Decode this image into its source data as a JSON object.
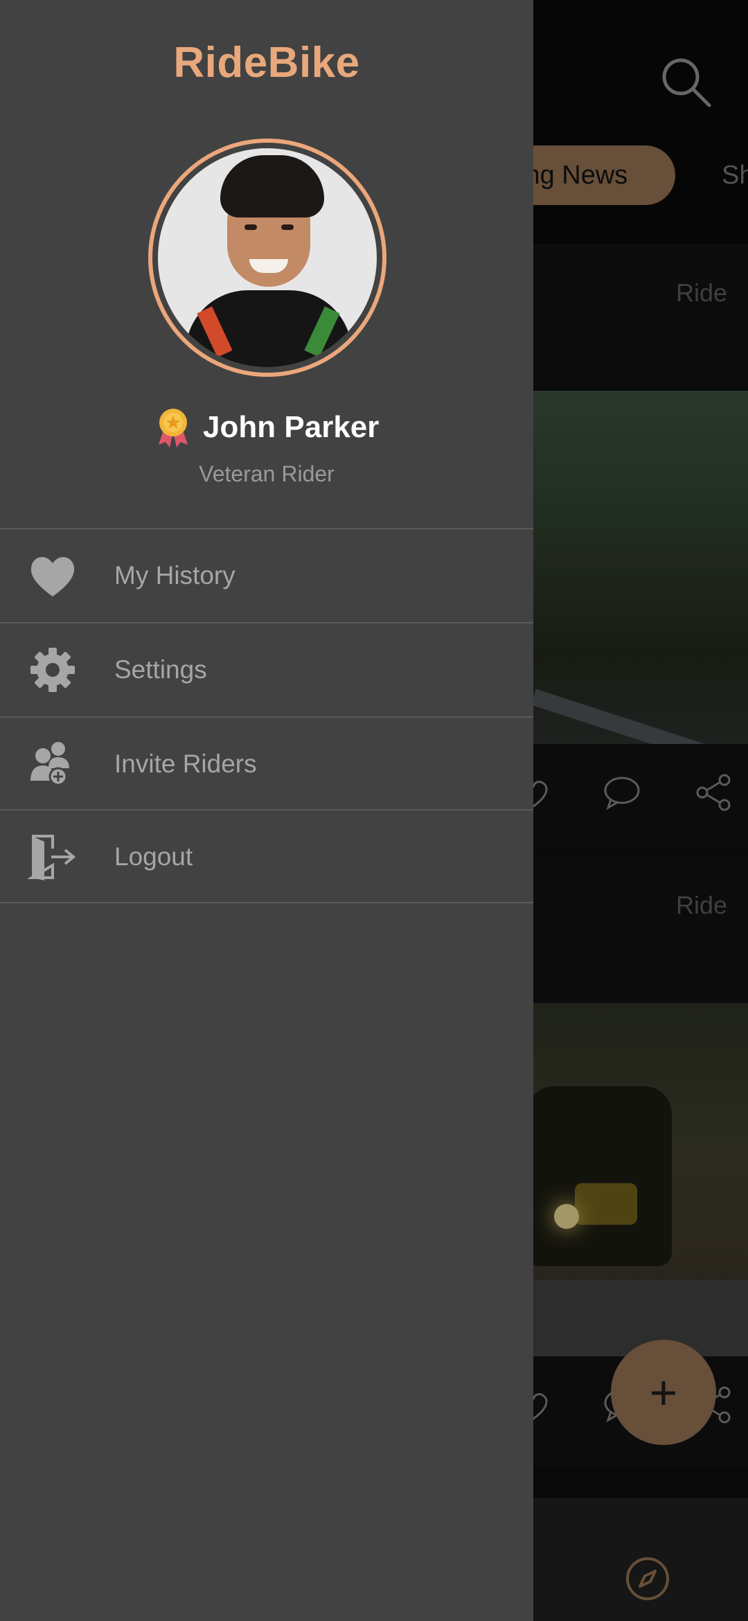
{
  "drawer": {
    "app_title": "RideBike",
    "user": {
      "name": "John Parker",
      "role": "Veteran Rider"
    },
    "menu": [
      {
        "label": "My History",
        "icon": "heart-icon"
      },
      {
        "label": "Settings",
        "icon": "gear-icon"
      },
      {
        "label": "Invite Riders",
        "icon": "invite-users-icon"
      },
      {
        "label": "Logout",
        "icon": "logout-icon"
      }
    ]
  },
  "background": {
    "tabs": [
      "ing News",
      "Sh"
    ],
    "posts": [
      {
        "tag": "Ride"
      },
      {
        "tag": "Ride"
      }
    ]
  },
  "colors": {
    "accent": "#e8a87c",
    "drawer_bg": "#424242",
    "fab": "#8b6a4d"
  }
}
